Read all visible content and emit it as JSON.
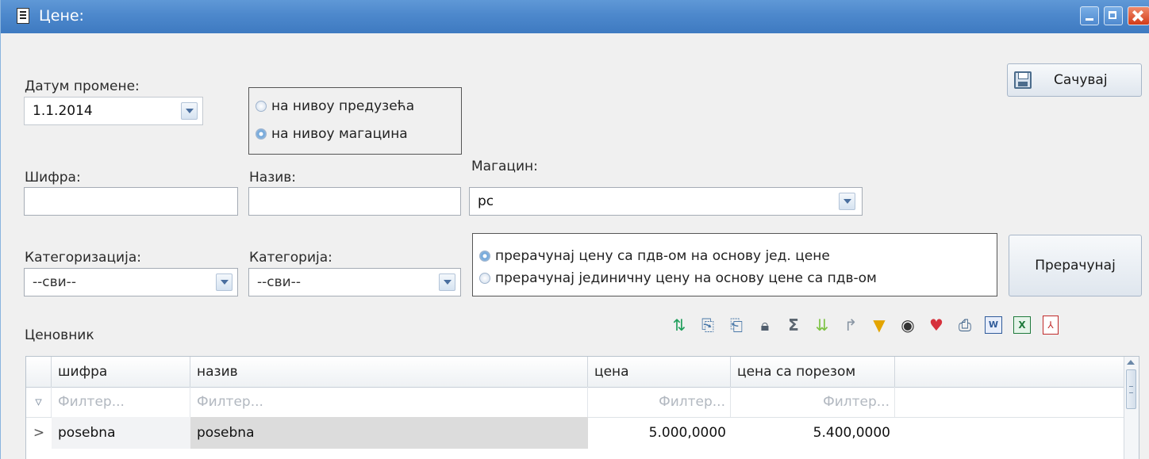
{
  "window": {
    "title": "Цене:"
  },
  "form": {
    "date_label": "Датум промене:",
    "date_value": "1.1.2014",
    "level_options": [
      "на нивоу предузећа",
      "на нивоу магацина"
    ],
    "level_selected": 1,
    "code_label": "Шифра:",
    "code_value": "",
    "name_label": "Назив:",
    "name_value": "",
    "warehouse_label": "Магацин:",
    "warehouse_value": "pc",
    "categorization_label": "Категоризација:",
    "categorization_value": "--сви--",
    "category_label": "Категорија:",
    "category_value": "--сви--",
    "calc_options": [
      "прерачунај цену са пдв-ом на основу јед. цене",
      "прерачунај јединичну цену на основу цене са пдв-ом"
    ],
    "calc_selected": 0,
    "save_label": "Сачувај",
    "recalc_label": "Прерачунај"
  },
  "pricelist": {
    "label": "Ценовник",
    "toolbar_icons": [
      "refresh-icon",
      "export-selected-icon",
      "export-all-icon",
      "lock-icon",
      "sum-icon",
      "expand-icon",
      "redirect-icon",
      "filter-icon",
      "view-icon",
      "favorite-icon",
      "print-icon",
      "word-export-icon",
      "excel-export-icon",
      "pdf-export-icon"
    ],
    "columns": [
      "шифра",
      "назив",
      "цена",
      "цена са порезом"
    ],
    "filter_placeholder": "Филтер...",
    "rows": [
      {
        "code": "posebna",
        "name": "posebna",
        "price": "5.000,0000",
        "price_tax": "5.400,0000"
      }
    ]
  }
}
